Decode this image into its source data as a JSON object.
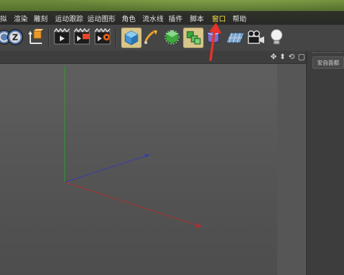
{
  "menu": {
    "items": [
      "拟",
      "渲染",
      "雕刻",
      "运动跟踪",
      "运动图形",
      "角色",
      "流水线",
      "插件",
      "脚本",
      "窗口",
      "帮助"
    ],
    "active_index": 9
  },
  "toolbar": {
    "icons": [
      "rotate-icon",
      "z-axis-icon",
      "coordinate-system-icon",
      "render-view-icon",
      "render-picture-viewer-icon",
      "render-settings-icon",
      "cube-primitive-icon",
      "pen-spline-icon",
      "subdivision-surface-icon",
      "array-generator-icon",
      "deformer-icon",
      "floor-environment-icon",
      "camera-icon",
      "light-icon"
    ]
  },
  "viewport": {
    "controls": [
      "✥",
      "⬍",
      "⟲",
      "▢"
    ]
  },
  "right_panel": {
    "button_label": "安自面都"
  },
  "colors": {
    "active_menu": "#ffe14a",
    "axis_x": "#b03030",
    "axis_y": "#2e9e2e",
    "axis_z": "#3a3ab0",
    "annotation_arrow": "#e8322a"
  }
}
